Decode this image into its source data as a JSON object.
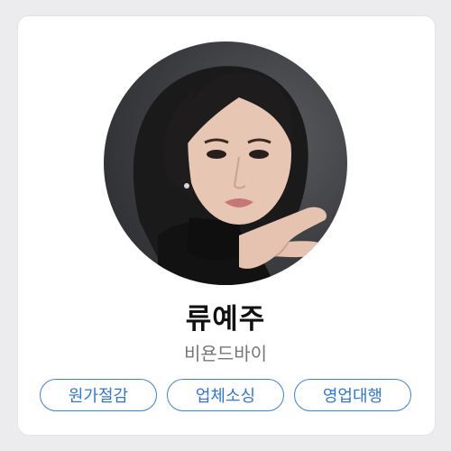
{
  "profile": {
    "name": "류예주",
    "company": "비욘드바이",
    "tags": [
      "원가절감",
      "업체소싱",
      "영업대행"
    ]
  },
  "colors": {
    "tag_border": "#3b82e0",
    "tag_text": "#2f76d8",
    "name_text": "#111111",
    "company_text": "#777777"
  }
}
